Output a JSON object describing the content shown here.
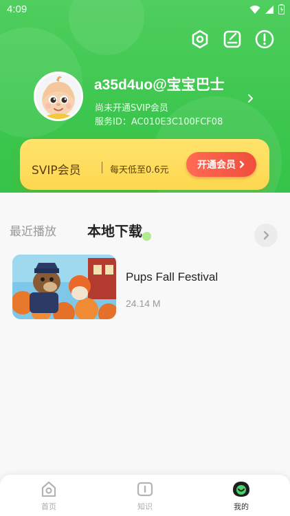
{
  "status_bar": {
    "time": "4:09"
  },
  "profile": {
    "username": "a35d4uo@宝宝巴士",
    "vip_status": "尚未开通SVIP会员",
    "service_id": "服务ID：AC010E3C100FCF08"
  },
  "top_actions": [
    "settings-icon",
    "edit-note-icon",
    "alert-icon"
  ],
  "vip_card": {
    "title": "SVIP会员",
    "price_text": "每天低至0.6元",
    "button_label": "开通会员"
  },
  "tabs": [
    {
      "label": "最近播放",
      "active": false
    },
    {
      "label": "本地下载",
      "active": true
    }
  ],
  "downloads": [
    {
      "title": "Pups Fall Festival",
      "size": "24.14 M"
    }
  ],
  "bottom_nav": [
    {
      "label": "首页",
      "icon": "home-icon",
      "active": false
    },
    {
      "label": "知识",
      "icon": "book-icon",
      "active": false
    },
    {
      "label": "我的",
      "icon": "profile-icon",
      "active": true
    }
  ],
  "colors": {
    "header_green": "#3cc64e",
    "vip_yellow": "#fdd84f",
    "vip_button_red": "#ef4e3c",
    "active_tab_accent": "#a6e77c"
  }
}
